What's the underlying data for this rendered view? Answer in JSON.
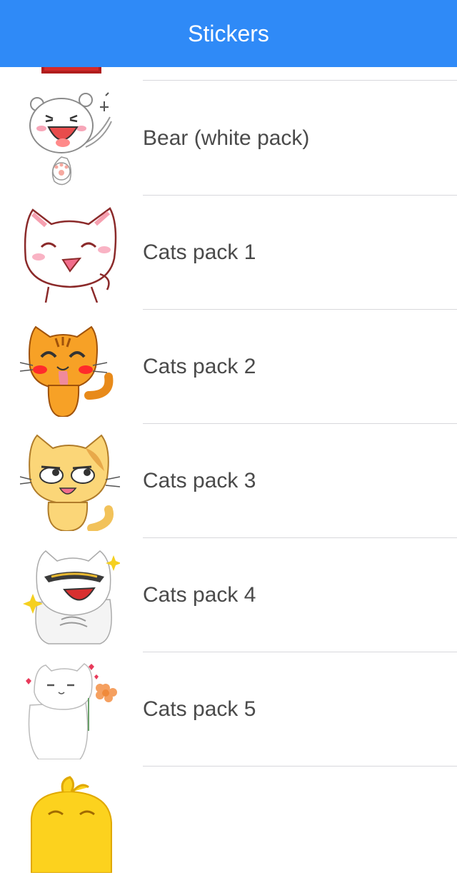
{
  "navbar": {
    "title": "Stickers"
  },
  "rows": [
    {
      "label": "Bear (white pack)",
      "icon": "white-bear-sticker-icon"
    },
    {
      "label": "Cats pack 1",
      "icon": "white-cat-sticker-icon"
    },
    {
      "label": "Cats pack 2",
      "icon": "orange-tiger-cat-sticker-icon"
    },
    {
      "label": "Cats pack 3",
      "icon": "yellow-cat-sticker-icon"
    },
    {
      "label": "Cats pack 4",
      "icon": "cool-cat-sunglasses-sticker-icon"
    },
    {
      "label": "Cats pack 5",
      "icon": "white-cat-flower-sticker-icon"
    }
  ],
  "colors": {
    "navbar": "#2f8af7",
    "separator": "#d8d8dc",
    "label": "#4a4a4a"
  }
}
